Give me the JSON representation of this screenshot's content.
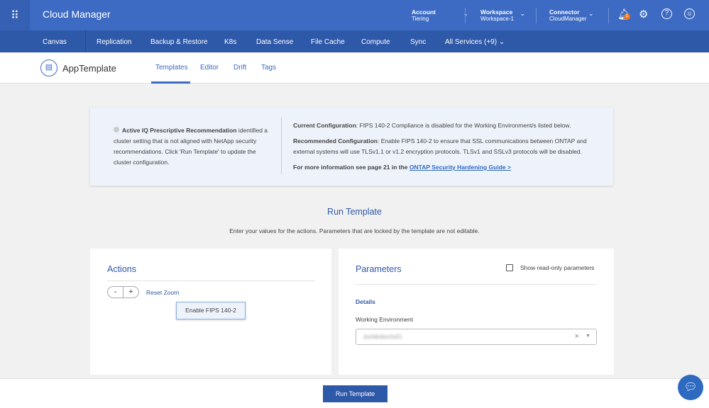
{
  "header": {
    "brand": "Cloud Manager",
    "account": {
      "label": "Account",
      "value": "Tiering"
    },
    "workspace": {
      "label": "Workspace",
      "value": "Workspace-1"
    },
    "connector": {
      "label": "Connector",
      "value": "CloudManager"
    },
    "notification_count": "1"
  },
  "nav": [
    "Canvas",
    "Replication",
    "Backup & Restore",
    "K8s",
    "Data Sense",
    "File Cache",
    "Compute",
    "Sync",
    "All Services (+9) ⌄"
  ],
  "app": {
    "title": "AppTemplate",
    "tabs": [
      "Templates",
      "Editor",
      "Drift",
      "Tags"
    ]
  },
  "recommendation": {
    "left_bold": "Active IQ Prescriptive Recommendation",
    "left_text": " identified a cluster setting that is not aligned with NetApp security recommendations. Click 'Run Template' to update the cluster configuration.",
    "current_label": "Current Configuration",
    "current_text": ": FIPS 140-2 Compliance is disabled for the Working Environment/s listed below.",
    "recommended_label": "Recommended Configuration",
    "recommended_text": ": Enable FIPS 140-2 to ensure that SSL communications between ONTAP and external systems will use TLSv1.1 or v1.2 encryption protocols. TLSv1 and SSLv3 protocols will be disabled.",
    "more_text": "For more information see page 21 in the ",
    "link": "ONTAP Security Hardening Guide >"
  },
  "run": {
    "title": "Run Template",
    "subtitle": "Enter your values for the actions. Parameters that are locked by the template are not editable."
  },
  "actions": {
    "title": "Actions",
    "minus": "-",
    "plus": "+",
    "reset": "Reset Zoom",
    "node": "Enable FIPS 140-2"
  },
  "parameters": {
    "title": "Parameters",
    "show_readonly": "Show read-only parameters",
    "section": "Details",
    "field_label": "Working Environment",
    "field_value": "durlabdevclu01"
  },
  "footer": {
    "run_button": "Run Template"
  }
}
